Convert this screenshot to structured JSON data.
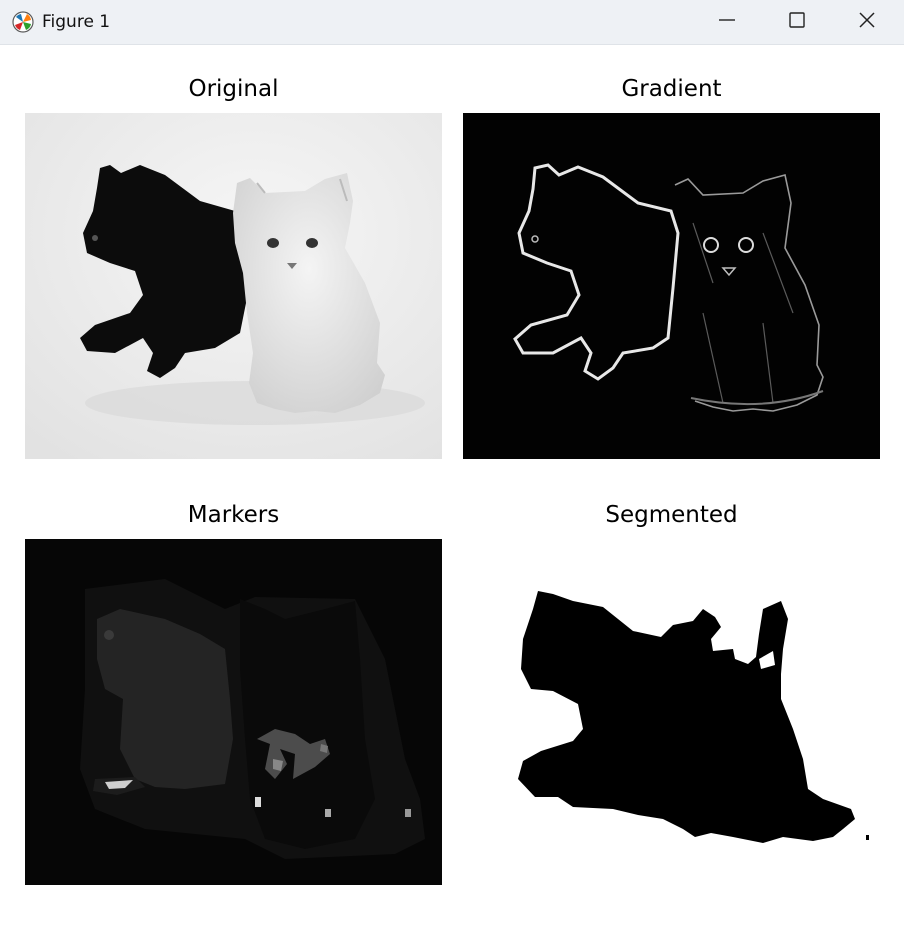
{
  "window": {
    "title": "Figure 1",
    "app_icon": "matplotlib-icon",
    "controls": [
      "minimize-icon",
      "maximize-icon",
      "close-icon"
    ]
  },
  "subplots": [
    {
      "title": "Original",
      "image": "grayscale photo of a black kitten and a white kitten on a light background"
    },
    {
      "title": "Gradient",
      "image": "edge magnitude map, bright outlines on black"
    },
    {
      "title": "Markers",
      "image": "dark label map with faint gray marker regions"
    },
    {
      "title": "Segmented",
      "image": "binary mask, black cats silhouette on white"
    }
  ],
  "colors": {
    "titlebar": "#eef1f5",
    "figure_bg": "#ffffff",
    "dark": "#000000",
    "light": "#ffffff"
  }
}
